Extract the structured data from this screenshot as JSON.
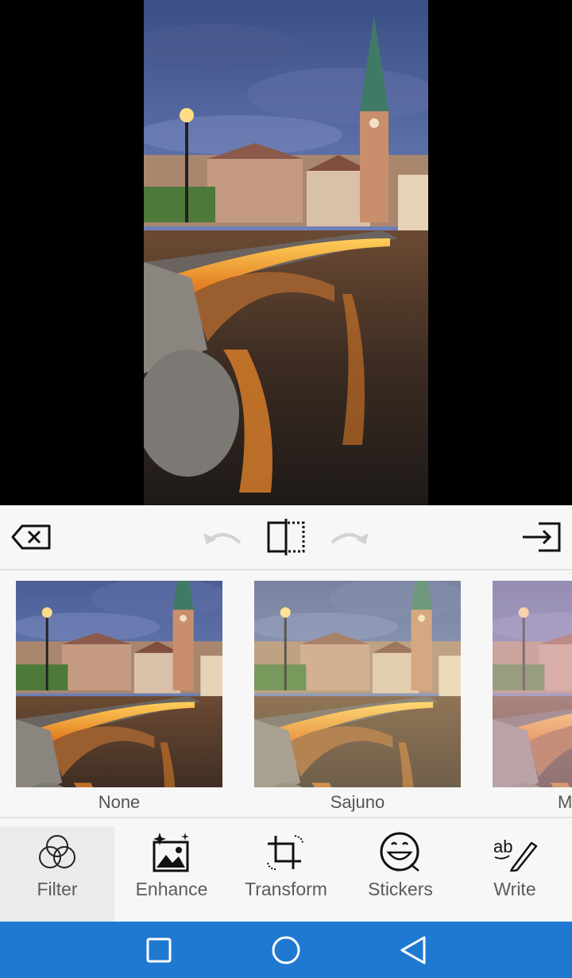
{
  "toolbar": {
    "icons": [
      "delete-back-icon",
      "undo-icon",
      "compare-icon",
      "redo-icon",
      "export-icon"
    ]
  },
  "filters": [
    {
      "label": "None"
    },
    {
      "label": "Sajuno"
    },
    {
      "label": "M"
    }
  ],
  "tabs": [
    {
      "label": "Filter",
      "icon": "filter-circles-icon",
      "active": true
    },
    {
      "label": "Enhance",
      "icon": "enhance-sparkle-icon",
      "active": false
    },
    {
      "label": "Transform",
      "icon": "crop-rotate-icon",
      "active": false
    },
    {
      "label": "Stickers",
      "icon": "smiley-icon",
      "active": false
    },
    {
      "label": "Write",
      "icon": "pen-text-icon",
      "active": false
    }
  ],
  "nav": {
    "icons": [
      "recents-square-icon",
      "home-circle-icon",
      "back-triangle-icon"
    ],
    "color": "#1f79d1"
  }
}
